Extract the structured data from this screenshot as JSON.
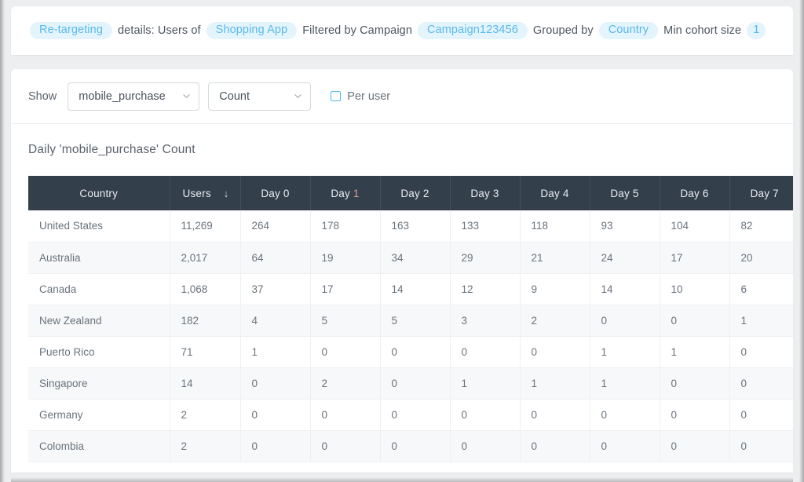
{
  "summary": {
    "audience_pill": "Re-targeting",
    "details_text": "details: Users of",
    "app_pill": "Shopping App",
    "filter_text": "Filtered by Campaign",
    "campaign_pill": "Campaign123456",
    "grouped_text": "Grouped by",
    "group_pill": "Country",
    "min_cohort_text": "Min cohort size",
    "min_cohort_value": "1"
  },
  "controls": {
    "show_label": "Show",
    "metric_value": "mobile_purchase",
    "aggregation_value": "Count",
    "per_user_label": "Per user",
    "per_user_checked": false,
    "metric_icon": "chevron-down-icon",
    "aggregation_icon": "chevron-down-icon"
  },
  "section": {
    "title": "Daily 'mobile_purchase' Count"
  },
  "table": {
    "columns": [
      "Country",
      "Users",
      "Day 0",
      "Day 1",
      "Day 2",
      "Day 3",
      "Day 4",
      "Day 5",
      "Day 6",
      "Day 7"
    ],
    "sort_column": "Users",
    "sort_icon": "arrow-down-icon",
    "sort_glyph": "↓",
    "rows": [
      {
        "country": "United States",
        "users": "11,269",
        "days": [
          "264",
          "178",
          "163",
          "133",
          "118",
          "93",
          "104",
          "82"
        ]
      },
      {
        "country": "Australia",
        "users": "2,017",
        "days": [
          "64",
          "19",
          "34",
          "29",
          "21",
          "24",
          "17",
          "20"
        ]
      },
      {
        "country": "Canada",
        "users": "1,068",
        "days": [
          "37",
          "17",
          "14",
          "12",
          "9",
          "14",
          "10",
          "6"
        ]
      },
      {
        "country": "New Zealand",
        "users": "182",
        "days": [
          "4",
          "5",
          "5",
          "3",
          "2",
          "0",
          "0",
          "1"
        ]
      },
      {
        "country": "Puerto Rico",
        "users": "71",
        "days": [
          "1",
          "0",
          "0",
          "0",
          "0",
          "1",
          "1",
          "0"
        ]
      },
      {
        "country": "Singapore",
        "users": "14",
        "days": [
          "0",
          "2",
          "0",
          "1",
          "1",
          "1",
          "0",
          "0"
        ]
      },
      {
        "country": "Germany",
        "users": "2",
        "days": [
          "0",
          "0",
          "0",
          "0",
          "0",
          "0",
          "0",
          "0"
        ]
      },
      {
        "country": "Colombia",
        "users": "2",
        "days": [
          "0",
          "0",
          "0",
          "0",
          "0",
          "0",
          "0",
          "0"
        ]
      }
    ]
  },
  "colors": {
    "pill_bg": "#e3f4fd",
    "pill_text": "#5ab9ec",
    "table_header_bg": "#343f4c",
    "accent": "#4fb8ef",
    "page_bg": "#eceef0"
  }
}
